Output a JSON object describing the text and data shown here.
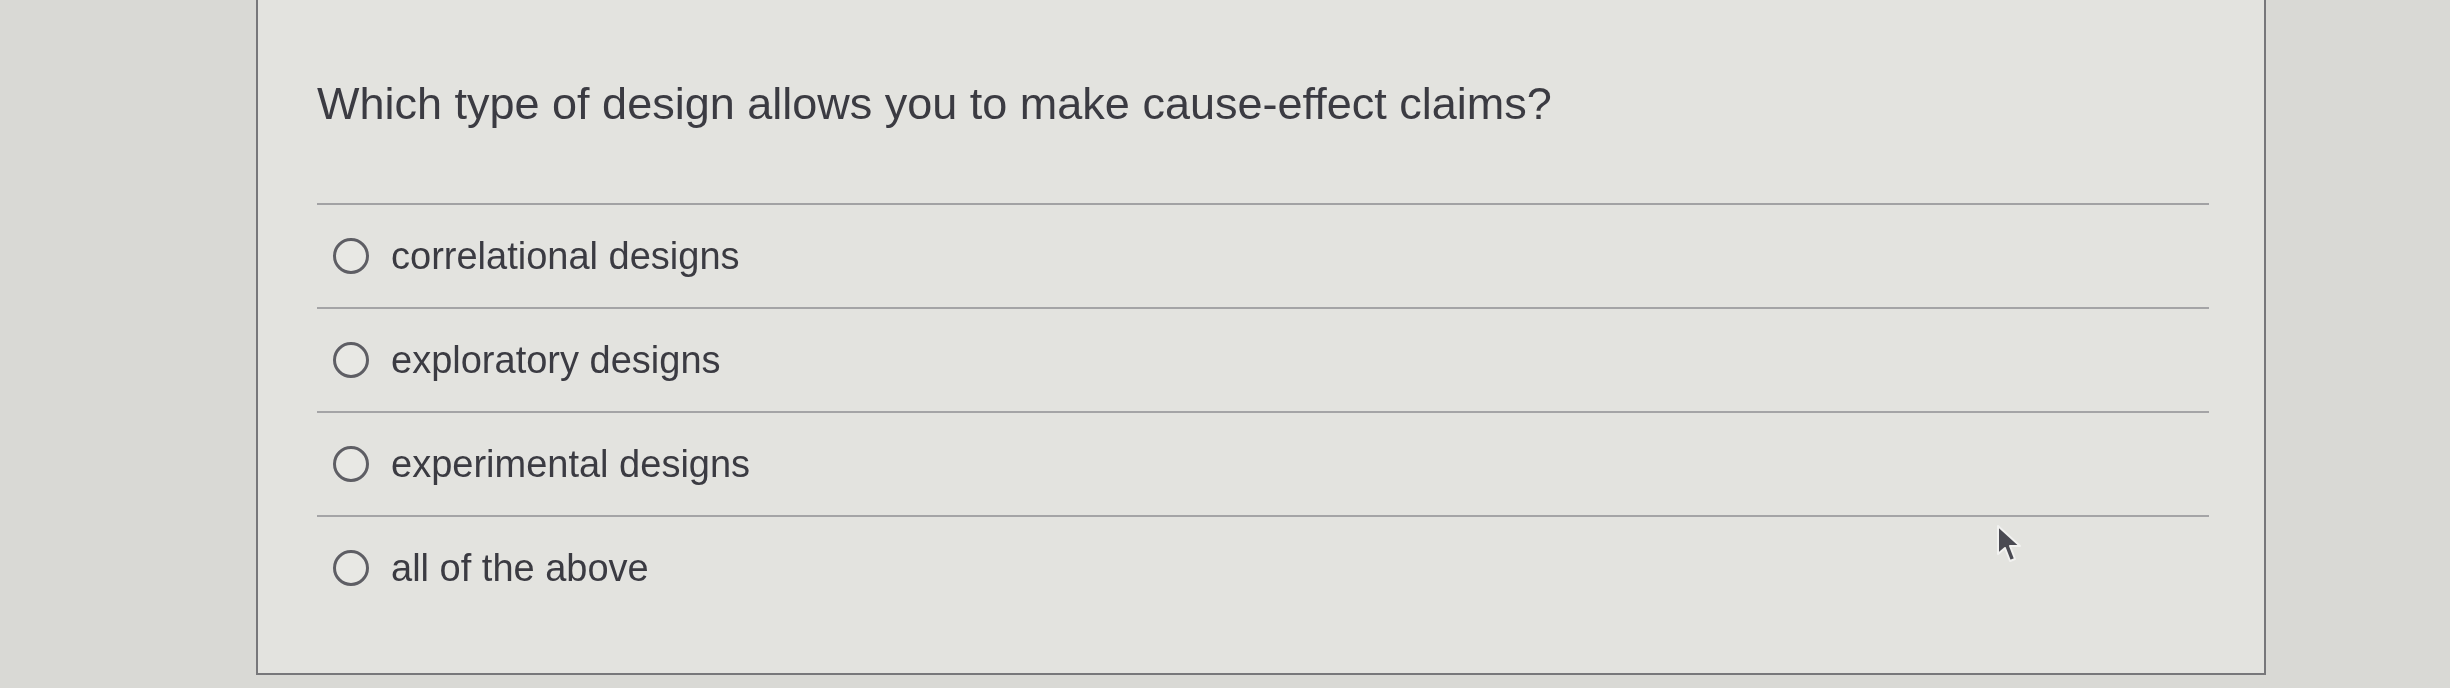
{
  "question": {
    "text": "Which type of design allows you to make cause-effect claims?"
  },
  "options": [
    {
      "label": "correlational designs",
      "selected": false
    },
    {
      "label": "exploratory designs",
      "selected": false
    },
    {
      "label": "experimental designs",
      "selected": false
    },
    {
      "label": "all of the above",
      "selected": false
    }
  ]
}
